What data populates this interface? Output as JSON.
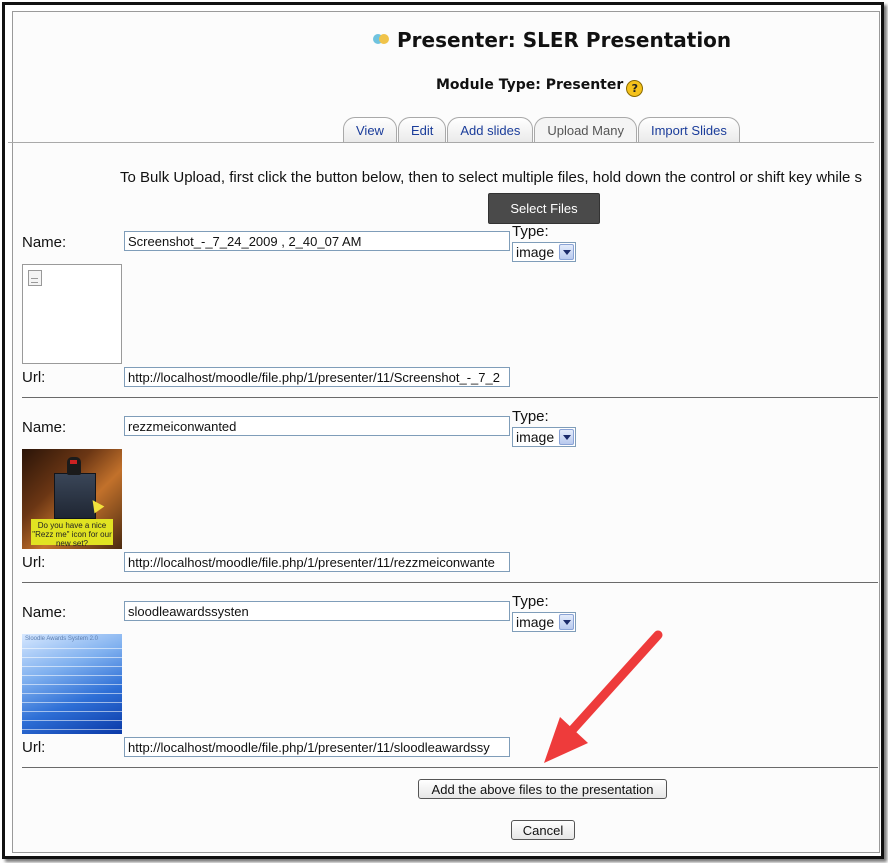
{
  "header": {
    "title": "Presenter: SLER Presentation",
    "module_type_label": "Module Type: Presenter"
  },
  "tabs": [
    {
      "label": "View",
      "active": false
    },
    {
      "label": "Edit",
      "active": false
    },
    {
      "label": "Add slides",
      "active": false
    },
    {
      "label": "Upload Many",
      "active": true
    },
    {
      "label": "Import Slides",
      "active": false
    }
  ],
  "upload": {
    "instructions": "To Bulk Upload, first click the button below, then to select multiple files, hold down the control or shift key while s",
    "select_files_label": "Select Files"
  },
  "labels": {
    "name": "Name:",
    "type": "Type:",
    "url": "Url:"
  },
  "files": [
    {
      "name": "Screenshot_-_7_24_2009 , 2_40_07 AM",
      "type": "image",
      "url": "http://localhost/moodle/file.php/1/presenter/11/Screenshot_-_7_2",
      "thumbnail": "broken-image"
    },
    {
      "name": "rezzmeiconwanted",
      "type": "image",
      "url": "http://localhost/moodle/file.php/1/presenter/11/rezzmeiconwante",
      "thumbnail": "rezz-me-scene",
      "thumb_text": "Do you have a nice \"Rezz me\" icon for our new set?"
    },
    {
      "name": "sloodleawardssysten",
      "type": "image",
      "url": "http://localhost/moodle/file.php/1/presenter/11/sloodleawardssy",
      "thumbnail": "blue-awards-slide",
      "thumb_text": "Sloodle Awards System 2.0"
    }
  ],
  "actions": {
    "add_label": "Add the above files to the presentation",
    "cancel_label": "Cancel"
  },
  "colors": {
    "tab_link": "#1a3c9a",
    "select_button": "#4a4a4a",
    "annotation_arrow": "#ee3b3b"
  }
}
